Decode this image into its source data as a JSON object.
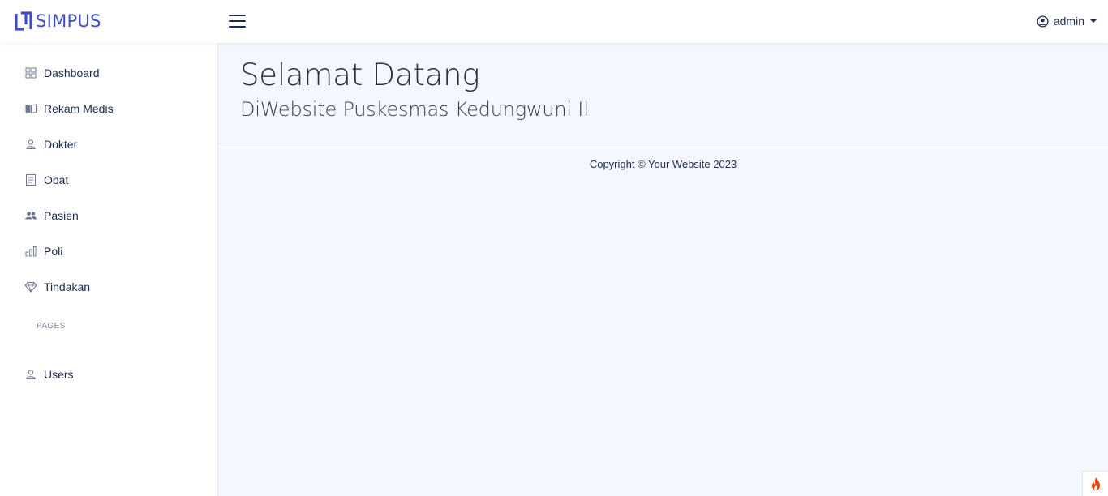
{
  "brand": {
    "name": "SIMPUS",
    "color": "#3f4ec7",
    "icon": "logo-mark-icon"
  },
  "topbar": {
    "menu_toggle_icon": "hamburger-menu-icon",
    "user": {
      "name": "admin",
      "icon": "user-circle-icon"
    }
  },
  "sidebar": {
    "items": [
      {
        "label": "Dashboard",
        "icon": "grid-icon"
      },
      {
        "label": "Rekam Medis",
        "icon": "book-open-icon"
      },
      {
        "label": "Dokter",
        "icon": "user-icon"
      },
      {
        "label": "Obat",
        "icon": "receipt-icon"
      },
      {
        "label": "Pasien",
        "icon": "users-icon"
      },
      {
        "label": "Poli",
        "icon": "bar-chart-icon"
      },
      {
        "label": "Tindakan",
        "icon": "diamond-icon"
      }
    ],
    "section_heading": "PAGES",
    "pages": [
      {
        "label": "Users",
        "icon": "user-icon"
      }
    ]
  },
  "main": {
    "title": "Selamat Datang",
    "subtitle": "DiWebsite Puskesmas Kedungwuni II",
    "footer": "Copyright © Your Website 2023"
  },
  "floating_button": {
    "icon": "flame-icon",
    "color": "#dd4814"
  }
}
